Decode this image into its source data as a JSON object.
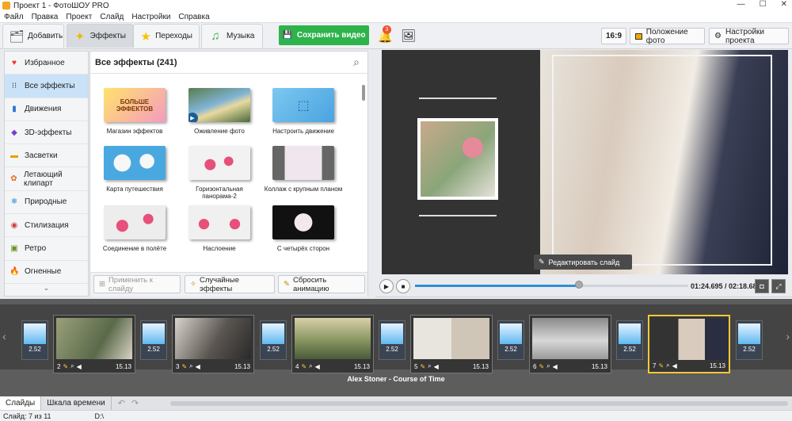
{
  "window": {
    "title": "Проект 1 - ФотоШОУ PRO"
  },
  "menu": [
    "Файл",
    "Правка",
    "Проект",
    "Слайд",
    "Настройки",
    "Справка"
  ],
  "tabs": [
    {
      "label": "Добавить",
      "icon": "add-photos-icon"
    },
    {
      "label": "Эффекты",
      "icon": "effects-icon"
    },
    {
      "label": "Переходы",
      "icon": "star-icon"
    },
    {
      "label": "Музыка",
      "icon": "music-icon"
    }
  ],
  "toolbar": {
    "save_label": "Сохранить видео",
    "notifications_count": "3",
    "aspect_label": "16:9",
    "photo_position_label": "Положение фото",
    "project_settings_label": "Настройки проекта"
  },
  "sidebar": {
    "items": [
      {
        "label": "Избранное",
        "icon": "heart-icon"
      },
      {
        "label": "Все эффекты",
        "icon": "grid-icon"
      },
      {
        "label": "Движения",
        "icon": "motion-icon"
      },
      {
        "label": "3D-эффекты",
        "icon": "3d-icon"
      },
      {
        "label": "Засветки",
        "icon": "light-icon"
      },
      {
        "label": "Летающий клипарт",
        "icon": "clipart-icon"
      },
      {
        "label": "Природные",
        "icon": "snowflake-icon"
      },
      {
        "label": "Стилизация",
        "icon": "style-icon"
      },
      {
        "label": "Ретро",
        "icon": "retro-icon"
      },
      {
        "label": "Огненные",
        "icon": "fire-icon"
      }
    ]
  },
  "effects": {
    "header": "Все эффекты (241)",
    "cards": [
      {
        "label": "Магазин эффектов",
        "thumb_text": "БОЛЬШЕ ЭФФЕКТОВ"
      },
      {
        "label": "Оживление фото"
      },
      {
        "label": "Настроить движение"
      },
      {
        "label": "Карта путешествия"
      },
      {
        "label": "Горизонтальная панорама-2"
      },
      {
        "label": "Коллаж с крупным планом"
      },
      {
        "label": "Соединение в полёте"
      },
      {
        "label": "Наслоение"
      },
      {
        "label": "С четырёх сторон"
      }
    ],
    "apply_label": "Применить к слайду",
    "random_label": "Случайные эффекты",
    "reset_label": "Сбросить анимацию"
  },
  "preview": {
    "edit_label": "Редактировать слайд"
  },
  "player": {
    "time": "01:24.695 / 02:18.688",
    "progress": 0.6
  },
  "timeline": {
    "slides": [
      {
        "num": "2",
        "dur": "15.13"
      },
      {
        "num": "3",
        "dur": "15.13"
      },
      {
        "num": "4",
        "dur": "15.13"
      },
      {
        "num": "5",
        "dur": "15.13"
      },
      {
        "num": "6",
        "dur": "15.13"
      },
      {
        "num": "7",
        "dur": "15.13"
      }
    ],
    "transitions": [
      "2.52",
      "2.52",
      "2.52",
      "2.52",
      "2.52",
      "2.52",
      "2.52"
    ],
    "music": "Alex Stoner - Course of Time"
  },
  "bottom_tabs": [
    "Слайды",
    "Шкала времени"
  ],
  "status": {
    "slide": "Слайд: 7 из 11",
    "path": "D:\\"
  },
  "colors": {
    "accent": "#2db34a",
    "selected": "#f4c83e",
    "active_nav": "#c9e2f8"
  }
}
